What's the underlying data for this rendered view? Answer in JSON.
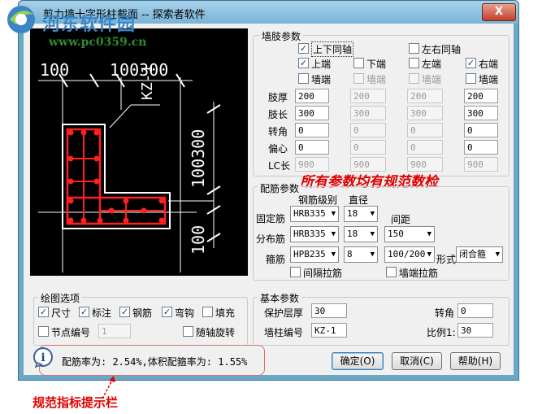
{
  "window": {
    "title": "剪力墙十字形柱截面 -- 探索者软件",
    "close_label": "X"
  },
  "watermark": {
    "text": "河东软件园",
    "url": "www.pc0359.cn"
  },
  "drawing": {
    "dim_top_left": "100",
    "dim_top_right": "100300",
    "column_label": "KZ-1",
    "dim_right": "100300",
    "dim_bottom": "100"
  },
  "wall_limb": {
    "title": "墙肢参数",
    "top_bottom_same": "上下同轴",
    "left_right_same": "左右同轴",
    "ends": [
      "上端",
      "下端",
      "左端",
      "右端"
    ],
    "wall_end": "墙端",
    "row_labels": [
      "肢厚",
      "肢长",
      "转角",
      "偏心",
      "LC长"
    ],
    "values": [
      [
        "200",
        "200",
        "200",
        "200"
      ],
      [
        "300",
        "300",
        "300",
        "300"
      ],
      [
        "0",
        "0",
        "0",
        "0"
      ],
      [
        "0",
        "0",
        "0",
        "0"
      ],
      [
        "900",
        "900",
        "900",
        "900"
      ]
    ]
  },
  "annotation_top": "所有参数均有规范数检",
  "rebar": {
    "title": "配筋参数",
    "col_grade": "钢筋级别",
    "col_dia": "直径",
    "col_spacing": "间距",
    "fixed_label": "固定筋",
    "fixed_grade": "HRB335",
    "fixed_dia": "18",
    "dist_label": "分布筋",
    "dist_grade": "HRB335",
    "dist_dia": "18",
    "dist_spacing": "150",
    "stirrup_label": "箍筋",
    "stirrup_grade": "HPB235",
    "stirrup_dia": "8",
    "stirrup_spacing": "100/200",
    "form_label": "形式",
    "form_value": "闭合箍",
    "tie_label": "间隔拉筋",
    "wall_end_tie_label": "墙端拉筋"
  },
  "draw_options": {
    "title": "绘图选项",
    "items": [
      "尺寸",
      "标注",
      "钢筋",
      "弯钩",
      "填充"
    ],
    "checked": [
      true,
      true,
      true,
      true,
      false
    ],
    "node_no": "节点编号",
    "node_no_value": "1",
    "rotate": "随轴旋转"
  },
  "basic": {
    "title": "基本参数",
    "cover_label": "保护层厚",
    "cover_value": "30",
    "id_label": "墙柱编号",
    "id_value": "KZ-1",
    "angle_label": "转角",
    "angle_value": "0",
    "scale_label": "比例1:",
    "scale_value": "30"
  },
  "status": {
    "icon": "i",
    "text": "配筋率为:  2.54%,体积配箍率为:  1.55%"
  },
  "buttons": {
    "ok": "确定(O)",
    "cancel": "取消(C)",
    "help": "帮助(H)"
  },
  "bottom_annotation": "规范指标提示栏",
  "colors": {
    "rebar": "#ff2020",
    "outline": "#ffffff",
    "annotation": "#e00000"
  }
}
